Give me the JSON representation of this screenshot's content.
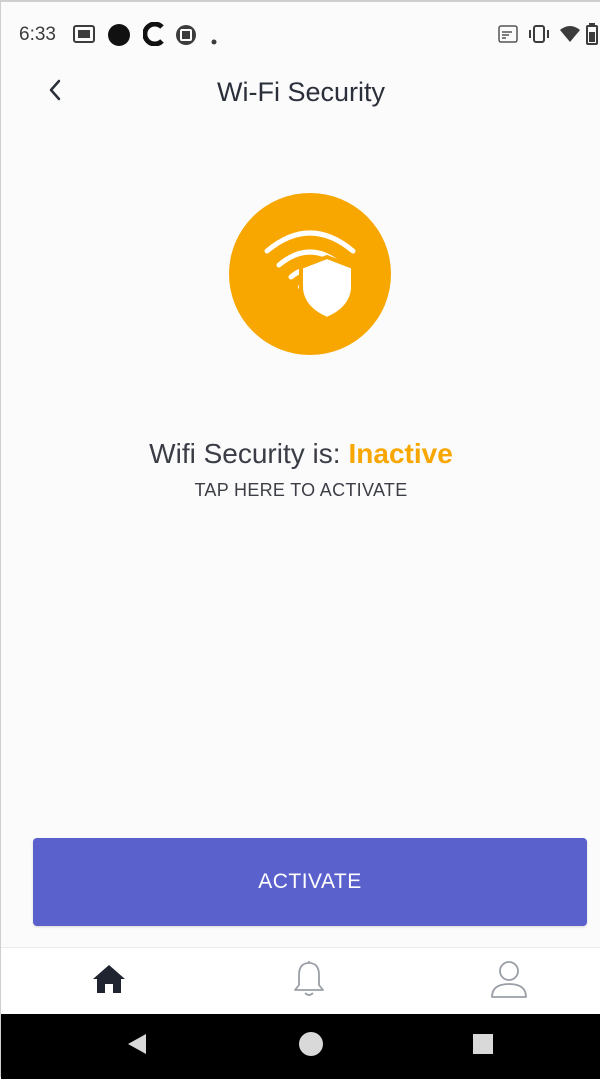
{
  "status_bar": {
    "time": "6:33",
    "left_icons": [
      "gmail-icon",
      "dot-icon",
      "c-app-icon",
      "cast-icon",
      "small-dot-icon"
    ],
    "right_icons": [
      "screen-cast-icon",
      "vibrate-icon",
      "wifi-icon",
      "battery-icon"
    ]
  },
  "header": {
    "title": "Wi-Fi Security",
    "back_icon": "chevron-left-icon"
  },
  "hero": {
    "icon": "wifi-shield-icon",
    "color": "#f8a600"
  },
  "status": {
    "label": "Wifi Security is:",
    "value": "Inactive",
    "value_color": "#f8a600",
    "tap_hint": "TAP HERE TO ACTIVATE"
  },
  "activate_button": {
    "label": "ACTIVATE",
    "color": "#5a61cd"
  },
  "bottom_nav": {
    "items": [
      {
        "icon": "home-icon",
        "active": true
      },
      {
        "icon": "bell-icon",
        "active": false
      },
      {
        "icon": "user-icon",
        "active": false
      }
    ]
  },
  "system_nav": {
    "items": [
      "back-triangle-icon",
      "home-circle-icon",
      "recents-square-icon"
    ]
  }
}
